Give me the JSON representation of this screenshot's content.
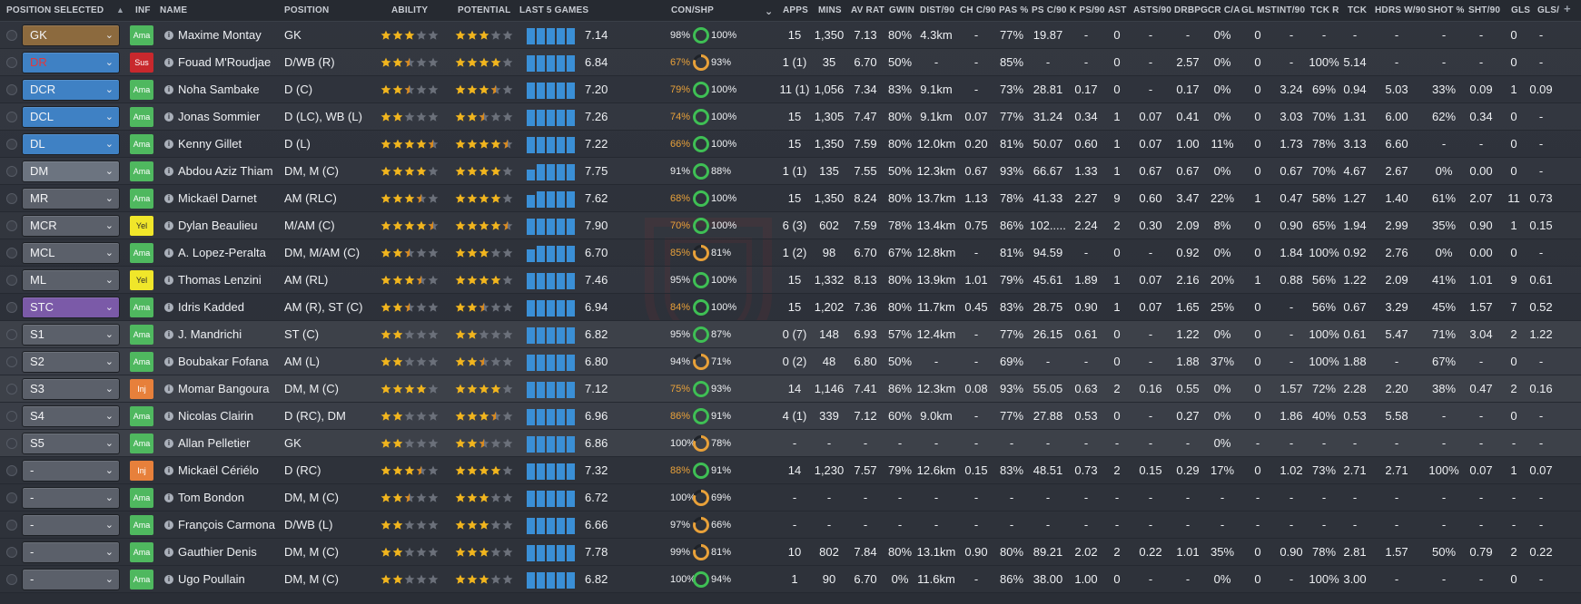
{
  "colors": {
    "accent_blue": "#3a8fd6",
    "star_gold": "#f1b51e",
    "star_half": "#d98a1f",
    "star_empty": "#6b707a",
    "ring_green": "#3fbf55",
    "ring_orange": "#e8a13a",
    "inf_ama": "#4fb85f",
    "inf_sus": "#c8282d",
    "inf_yel": "#f0e62a",
    "inf_inj": "#e7803b",
    "sel_default": "#5b606a",
    "sel_gk": "#8c6a3e",
    "sel_dr": "#3f81c4",
    "sel_dm": "#6c7480",
    "sel_stc": "#7b5aa8"
  },
  "headers": {
    "position_selected": "POSITION SELECTED",
    "inf": "INF",
    "name": "NAME",
    "position": "POSITION",
    "ability": "ABILITY",
    "potential": "POTENTIAL",
    "last5": "LAST 5 GAMES",
    "conshp": "CON/SHP",
    "apps": "APPS",
    "mins": "MINS",
    "avrat": "AV RAT",
    "gwin": "GWIN",
    "dist": "DIST/90",
    "chc90": "CH C/90",
    "pas": "PAS %",
    "psc90": "PS C/90",
    "kps90": "K PS/90",
    "ast": "AST",
    "asts90": "ASTS/90",
    "drbpg": "DRBPG",
    "crca": "CR C/A",
    "glmst": "GL MST",
    "int90": "INT/90",
    "tckr": "TCK R",
    "tck": "TCK",
    "hdrsw90": "HDRS W/90",
    "shotpct": "SHOT %",
    "sht90": "SHT/90",
    "gls": "GLS",
    "gls90": "GLS/"
  },
  "players": [
    {
      "sel": "GK",
      "selc": "gk",
      "inf": "Ama",
      "name": "Maxime Montay",
      "pos": "GK",
      "ab": 3,
      "po": 3,
      "bars": [
        16,
        16,
        16,
        16,
        16
      ],
      "avg": "7.14",
      "con": "98%",
      "shp": "100%",
      "ring": "g",
      "apps": "15",
      "mins": "1,350",
      "avr": "7.13",
      "gwin": "80%",
      "dist": "4.3km",
      "chc": "-",
      "pas": "77%",
      "psc": "19.87",
      "kps": "-",
      "ast": "0",
      "asts": "-",
      "drb": "-",
      "crca": "0%",
      "glm": "0",
      "int": "-",
      "tckr": "-",
      "tck": "-",
      "hdr": "-",
      "shp2": "-",
      "sht": "-",
      "gls": "0",
      "gl9": "-",
      "tier": "s"
    },
    {
      "sel": "DR",
      "selc": "dr",
      "inf": "Sus",
      "name": "Fouad M'Roudjae",
      "pos": "D/WB (R)",
      "ab": 2.5,
      "po": 4,
      "bars": [
        16,
        16,
        16,
        16,
        16
      ],
      "avg": "6.84",
      "con": "67%",
      "shp": "93%",
      "ring": "o",
      "apps": "1 (1)",
      "mins": "35",
      "avr": "6.70",
      "gwin": "50%",
      "dist": "-",
      "chc": "-",
      "pas": "85%",
      "psc": "-",
      "kps": "-",
      "ast": "0",
      "asts": "-",
      "drb": "2.57",
      "crca": "0%",
      "glm": "0",
      "int": "-",
      "tckr": "100%",
      "tck": "5.14",
      "hdr": "-",
      "shp2": "-",
      "sht": "-",
      "gls": "0",
      "gl9": "-",
      "tier": "s"
    },
    {
      "sel": "DCR",
      "selc": "dr",
      "inf": "Ama",
      "name": "Noha Sambake",
      "pos": "D (C)",
      "ab": 2.5,
      "po": 3.5,
      "bars": [
        16,
        16,
        16,
        16,
        16
      ],
      "avg": "7.20",
      "con": "79%",
      "shp": "100%",
      "ring": "g",
      "apps": "11 (1)",
      "mins": "1,056",
      "avr": "7.34",
      "gwin": "83%",
      "dist": "9.1km",
      "chc": "-",
      "pas": "73%",
      "psc": "28.81",
      "kps": "0.17",
      "ast": "0",
      "asts": "-",
      "drb": "0.17",
      "crca": "0%",
      "glm": "0",
      "int": "3.24",
      "tckr": "69%",
      "tck": "0.94",
      "hdr": "5.03",
      "shp2": "33%",
      "sht": "0.09",
      "gls": "1",
      "gl9": "0.09",
      "tier": "s"
    },
    {
      "sel": "DCL",
      "selc": "dr",
      "inf": "Ama",
      "name": "Jonas Sommier",
      "pos": "D (LC), WB (L)",
      "ab": 2,
      "po": 2.5,
      "bars": [
        16,
        16,
        16,
        16,
        16
      ],
      "avg": "7.26",
      "con": "74%",
      "shp": "100%",
      "ring": "g",
      "apps": "15",
      "mins": "1,305",
      "avr": "7.47",
      "gwin": "80%",
      "dist": "9.1km",
      "chc": "0.07",
      "pas": "77%",
      "psc": "31.24",
      "kps": "0.34",
      "ast": "1",
      "asts": "0.07",
      "drb": "0.41",
      "crca": "0%",
      "glm": "0",
      "int": "3.03",
      "tckr": "70%",
      "tck": "1.31",
      "hdr": "6.00",
      "shp2": "62%",
      "sht": "0.34",
      "gls": "0",
      "gl9": "-",
      "tier": "s"
    },
    {
      "sel": "DL",
      "selc": "dr",
      "inf": "Ama",
      "name": "Kenny Gillet",
      "pos": "D (L)",
      "ab": 4.5,
      "po": 4.5,
      "bars": [
        16,
        16,
        16,
        16,
        16
      ],
      "avg": "7.22",
      "con": "66%",
      "shp": "100%",
      "ring": "g",
      "apps": "15",
      "mins": "1,350",
      "avr": "7.59",
      "gwin": "80%",
      "dist": "12.0km",
      "chc": "0.20",
      "pas": "81%",
      "psc": "50.07",
      "kps": "0.60",
      "ast": "1",
      "asts": "0.07",
      "drb": "1.00",
      "crca": "11%",
      "glm": "0",
      "int": "1.73",
      "tckr": "78%",
      "tck": "3.13",
      "hdr": "6.60",
      "shp2": "-",
      "sht": "-",
      "gls": "0",
      "gl9": "-",
      "tier": "s"
    },
    {
      "sel": "DM",
      "selc": "dm",
      "inf": "Ama",
      "name": "Abdou Aziz Thiam",
      "pos": "DM, M (C)",
      "ab": 4,
      "po": 4,
      "bars": [
        10,
        16,
        16,
        16,
        16
      ],
      "avg": "7.75",
      "con": "91%",
      "shp": "88%",
      "ring": "g",
      "apps": "1 (1)",
      "mins": "135",
      "avr": "7.55",
      "gwin": "50%",
      "dist": "12.3km",
      "chc": "0.67",
      "pas": "93%",
      "psc": "66.67",
      "kps": "1.33",
      "ast": "1",
      "asts": "0.67",
      "drb": "0.67",
      "crca": "0%",
      "glm": "0",
      "int": "0.67",
      "tckr": "70%",
      "tck": "4.67",
      "hdr": "2.67",
      "shp2": "0%",
      "sht": "0.00",
      "gls": "0",
      "gl9": "-",
      "tier": "s"
    },
    {
      "sel": "MR",
      "selc": "def",
      "inf": "Ama",
      "name": "Mickaël Darnet",
      "pos": "AM (RLC)",
      "ab": 3.5,
      "po": 4,
      "bars": [
        12,
        16,
        16,
        16,
        16
      ],
      "avg": "7.62",
      "con": "68%",
      "shp": "100%",
      "ring": "g",
      "apps": "15",
      "mins": "1,350",
      "avr": "8.24",
      "gwin": "80%",
      "dist": "13.7km",
      "chc": "1.13",
      "pas": "78%",
      "psc": "41.33",
      "kps": "2.27",
      "ast": "9",
      "asts": "0.60",
      "drb": "3.47",
      "crca": "22%",
      "glm": "1",
      "int": "0.47",
      "tckr": "58%",
      "tck": "1.27",
      "hdr": "1.40",
      "shp2": "61%",
      "sht": "2.07",
      "gls": "11",
      "gl9": "0.73",
      "tier": "s"
    },
    {
      "sel": "MCR",
      "selc": "def",
      "inf": "Yel",
      "name": "Dylan Beaulieu",
      "pos": "M/AM (C)",
      "ab": 4.5,
      "po": 4.5,
      "bars": [
        16,
        16,
        16,
        16,
        16
      ],
      "avg": "7.90",
      "con": "70%",
      "shp": "100%",
      "ring": "g",
      "apps": "6 (3)",
      "mins": "602",
      "avr": "7.59",
      "gwin": "78%",
      "dist": "13.4km",
      "chc": "0.75",
      "pas": "86%",
      "psc": "102.....",
      "kps": "2.24",
      "ast": "2",
      "asts": "0.30",
      "drb": "2.09",
      "crca": "8%",
      "glm": "0",
      "int": "0.90",
      "tckr": "65%",
      "tck": "1.94",
      "hdr": "2.99",
      "shp2": "35%",
      "sht": "0.90",
      "gls": "1",
      "gl9": "0.15",
      "tier": "s"
    },
    {
      "sel": "MCL",
      "selc": "def",
      "inf": "Ama",
      "name": "A. Lopez-Peralta",
      "pos": "DM, M/AM (C)",
      "ab": 2.5,
      "po": 3,
      "bars": [
        12,
        16,
        16,
        16,
        16
      ],
      "avg": "6.70",
      "con": "85%",
      "shp": "81%",
      "ring": "o",
      "apps": "1 (2)",
      "mins": "98",
      "avr": "6.70",
      "gwin": "67%",
      "dist": "12.8km",
      "chc": "-",
      "pas": "81%",
      "psc": "94.59",
      "kps": "-",
      "ast": "0",
      "asts": "-",
      "drb": "0.92",
      "crca": "0%",
      "glm": "0",
      "int": "1.84",
      "tckr": "100%",
      "tck": "0.92",
      "hdr": "2.76",
      "shp2": "0%",
      "sht": "0.00",
      "gls": "0",
      "gl9": "-",
      "tier": "s"
    },
    {
      "sel": "ML",
      "selc": "def",
      "inf": "Yel",
      "name": "Thomas Lenzini",
      "pos": "AM (RL)",
      "ab": 3.5,
      "po": 4,
      "bars": [
        16,
        16,
        16,
        16,
        16
      ],
      "avg": "7.46",
      "con": "95%",
      "shp": "100%",
      "ring": "g",
      "apps": "15",
      "mins": "1,332",
      "avr": "8.13",
      "gwin": "80%",
      "dist": "13.9km",
      "chc": "1.01",
      "pas": "79%",
      "psc": "45.61",
      "kps": "1.89",
      "ast": "1",
      "asts": "0.07",
      "drb": "2.16",
      "crca": "20%",
      "glm": "1",
      "int": "0.88",
      "tckr": "56%",
      "tck": "1.22",
      "hdr": "2.09",
      "shp2": "41%",
      "sht": "1.01",
      "gls": "9",
      "gl9": "0.61",
      "tier": "s"
    },
    {
      "sel": "STC",
      "selc": "stc",
      "inf": "Ama",
      "name": "Idris Kadded",
      "pos": "AM (R), ST (C)",
      "ab": 2.5,
      "po": 2.5,
      "bars": [
        16,
        16,
        16,
        16,
        16
      ],
      "avg": "6.94",
      "con": "84%",
      "shp": "100%",
      "ring": "g",
      "apps": "15",
      "mins": "1,202",
      "avr": "7.36",
      "gwin": "80%",
      "dist": "11.7km",
      "chc": "0.45",
      "pas": "83%",
      "psc": "28.75",
      "kps": "0.90",
      "ast": "1",
      "asts": "0.07",
      "drb": "1.65",
      "crca": "25%",
      "glm": "0",
      "int": "-",
      "tckr": "56%",
      "tck": "0.67",
      "hdr": "3.29",
      "shp2": "45%",
      "sht": "1.57",
      "gls": "7",
      "gl9": "0.52",
      "tier": "s"
    },
    {
      "sel": "S1",
      "selc": "def",
      "inf": "Ama",
      "name": "J. Mandrichi",
      "pos": "ST (C)",
      "ab": 2,
      "po": 2,
      "bars": [
        16,
        16,
        16,
        16,
        16
      ],
      "avg": "6.82",
      "con": "95%",
      "shp": "87%",
      "ring": "g",
      "apps": "0 (7)",
      "mins": "148",
      "avr": "6.93",
      "gwin": "57%",
      "dist": "12.4km",
      "chc": "-",
      "pas": "77%",
      "psc": "26.15",
      "kps": "0.61",
      "ast": "0",
      "asts": "-",
      "drb": "1.22",
      "crca": "0%",
      "glm": "0",
      "int": "-",
      "tckr": "100%",
      "tck": "0.61",
      "hdr": "5.47",
      "shp2": "71%",
      "sht": "3.04",
      "gls": "2",
      "gl9": "1.22",
      "tier": "b"
    },
    {
      "sel": "S2",
      "selc": "def",
      "inf": "Ama",
      "name": "Boubakar Fofana",
      "pos": "AM (L)",
      "ab": 2,
      "po": 2.5,
      "bars": [
        16,
        16,
        16,
        16,
        16
      ],
      "avg": "6.80",
      "con": "94%",
      "shp": "71%",
      "ring": "o",
      "apps": "0 (2)",
      "mins": "48",
      "avr": "6.80",
      "gwin": "50%",
      "dist": "-",
      "chc": "-",
      "pas": "69%",
      "psc": "-",
      "kps": "-",
      "ast": "0",
      "asts": "-",
      "drb": "1.88",
      "crca": "37%",
      "glm": "0",
      "int": "-",
      "tckr": "100%",
      "tck": "1.88",
      "hdr": "-",
      "shp2": "67%",
      "sht": "-",
      "gls": "0",
      "gl9": "-",
      "tier": "b"
    },
    {
      "sel": "S3",
      "selc": "def",
      "inf": "Inj",
      "name": "Momar Bangoura",
      "pos": "DM, M (C)",
      "ab": 4,
      "po": 4,
      "bars": [
        16,
        16,
        16,
        16,
        16
      ],
      "avg": "7.12",
      "con": "75%",
      "shp": "93%",
      "ring": "g",
      "apps": "14",
      "mins": "1,146",
      "avr": "7.41",
      "gwin": "86%",
      "dist": "12.3km",
      "chc": "0.08",
      "pas": "93%",
      "psc": "55.05",
      "kps": "0.63",
      "ast": "2",
      "asts": "0.16",
      "drb": "0.55",
      "crca": "0%",
      "glm": "0",
      "int": "1.57",
      "tckr": "72%",
      "tck": "2.28",
      "hdr": "2.20",
      "shp2": "38%",
      "sht": "0.47",
      "gls": "2",
      "gl9": "0.16",
      "tier": "b"
    },
    {
      "sel": "S4",
      "selc": "def",
      "inf": "Ama",
      "name": "Nicolas Clairin",
      "pos": "D (RC), DM",
      "ab": 2,
      "po": 3.5,
      "bars": [
        16,
        16,
        16,
        16,
        16
      ],
      "avg": "6.96",
      "con": "86%",
      "shp": "91%",
      "ring": "g",
      "apps": "4 (1)",
      "mins": "339",
      "avr": "7.12",
      "gwin": "60%",
      "dist": "9.0km",
      "chc": "-",
      "pas": "77%",
      "psc": "27.88",
      "kps": "0.53",
      "ast": "0",
      "asts": "-",
      "drb": "0.27",
      "crca": "0%",
      "glm": "0",
      "int": "1.86",
      "tckr": "40%",
      "tck": "0.53",
      "hdr": "5.58",
      "shp2": "-",
      "sht": "-",
      "gls": "0",
      "gl9": "-",
      "tier": "b"
    },
    {
      "sel": "S5",
      "selc": "def",
      "inf": "Ama",
      "name": "Allan Pelletier",
      "pos": "GK",
      "ab": 2,
      "po": 2.5,
      "bars": [
        16,
        16,
        16,
        16,
        16
      ],
      "avg": "6.86",
      "con": "100%",
      "shp": "78%",
      "ring": "o",
      "apps": "-",
      "mins": "-",
      "avr": "-",
      "gwin": "-",
      "dist": "-",
      "chc": "-",
      "pas": "-",
      "psc": "-",
      "kps": "-",
      "ast": "-",
      "asts": "-",
      "drb": "-",
      "crca": "0%",
      "glm": "-",
      "int": "-",
      "tckr": "-",
      "tck": "-",
      "hdr": "-",
      "shp2": "-",
      "sht": "-",
      "gls": "-",
      "gl9": "-",
      "tier": "b"
    },
    {
      "sel": "-",
      "selc": "def",
      "inf": "Inj",
      "name": "Mickaël Cériélo",
      "pos": "D (RC)",
      "ab": 3.5,
      "po": 4,
      "bars": [
        16,
        16,
        16,
        16,
        16
      ],
      "avg": "7.32",
      "con": "88%",
      "shp": "91%",
      "ring": "g",
      "apps": "14",
      "mins": "1,230",
      "avr": "7.57",
      "gwin": "79%",
      "dist": "12.6km",
      "chc": "0.15",
      "pas": "83%",
      "psc": "48.51",
      "kps": "0.73",
      "ast": "2",
      "asts": "0.15",
      "drb": "0.29",
      "crca": "17%",
      "glm": "0",
      "int": "1.02",
      "tckr": "73%",
      "tck": "2.71",
      "hdr": "2.71",
      "shp2": "100%",
      "sht": "0.07",
      "gls": "1",
      "gl9": "0.07",
      "tier": "r"
    },
    {
      "sel": "-",
      "selc": "def",
      "inf": "Ama",
      "name": "Tom Bondon",
      "pos": "DM, M (C)",
      "ab": 2.5,
      "po": 3,
      "bars": [
        16,
        16,
        16,
        16,
        16
      ],
      "avg": "6.72",
      "con": "100%",
      "shp": "69%",
      "ring": "o",
      "apps": "-",
      "mins": "-",
      "avr": "-",
      "gwin": "-",
      "dist": "-",
      "chc": "-",
      "pas": "-",
      "psc": "-",
      "kps": "-",
      "ast": "-",
      "asts": "-",
      "drb": "-",
      "crca": "-",
      "glm": "-",
      "int": "-",
      "tckr": "-",
      "tck": "-",
      "hdr": "-",
      "shp2": "-",
      "sht": "-",
      "gls": "-",
      "gl9": "-",
      "tier": "r"
    },
    {
      "sel": "-",
      "selc": "def",
      "inf": "Ama",
      "name": "François Carmona",
      "pos": "D/WB (L)",
      "ab": 2,
      "po": 3,
      "bars": [
        16,
        16,
        16,
        16,
        16
      ],
      "avg": "6.66",
      "con": "97%",
      "shp": "66%",
      "ring": "o",
      "apps": "-",
      "mins": "-",
      "avr": "-",
      "gwin": "-",
      "dist": "-",
      "chc": "-",
      "pas": "-",
      "psc": "-",
      "kps": "-",
      "ast": "-",
      "asts": "-",
      "drb": "-",
      "crca": "-",
      "glm": "-",
      "int": "-",
      "tckr": "-",
      "tck": "-",
      "hdr": "-",
      "shp2": "-",
      "sht": "-",
      "gls": "-",
      "gl9": "-",
      "tier": "r"
    },
    {
      "sel": "-",
      "selc": "def",
      "inf": "Ama",
      "name": "Gauthier Denis",
      "pos": "DM, M (C)",
      "ab": 2,
      "po": 3,
      "bars": [
        16,
        16,
        16,
        16,
        16
      ],
      "avg": "7.78",
      "con": "99%",
      "shp": "81%",
      "ring": "o",
      "apps": "10",
      "mins": "802",
      "avr": "7.84",
      "gwin": "80%",
      "dist": "13.1km",
      "chc": "0.90",
      "pas": "80%",
      "psc": "89.21",
      "kps": "2.02",
      "ast": "2",
      "asts": "0.22",
      "drb": "1.01",
      "crca": "35%",
      "glm": "0",
      "int": "0.90",
      "tckr": "78%",
      "tck": "2.81",
      "hdr": "1.57",
      "shp2": "50%",
      "sht": "0.79",
      "gls": "2",
      "gl9": "0.22",
      "tier": "r"
    },
    {
      "sel": "-",
      "selc": "def",
      "inf": "Ama",
      "name": "Ugo Poullain",
      "pos": "DM, M (C)",
      "ab": 2,
      "po": 3,
      "bars": [
        16,
        16,
        16,
        16,
        16
      ],
      "avg": "6.82",
      "con": "100%",
      "shp": "94%",
      "ring": "g",
      "apps": "1",
      "mins": "90",
      "avr": "6.70",
      "gwin": "0%",
      "dist": "11.6km",
      "chc": "-",
      "pas": "86%",
      "psc": "38.00",
      "kps": "1.00",
      "ast": "0",
      "asts": "-",
      "drb": "-",
      "crca": "0%",
      "glm": "0",
      "int": "-",
      "tckr": "100%",
      "tck": "3.00",
      "hdr": "-",
      "shp2": "-",
      "sht": "-",
      "gls": "0",
      "gl9": "-",
      "tier": "r"
    }
  ]
}
